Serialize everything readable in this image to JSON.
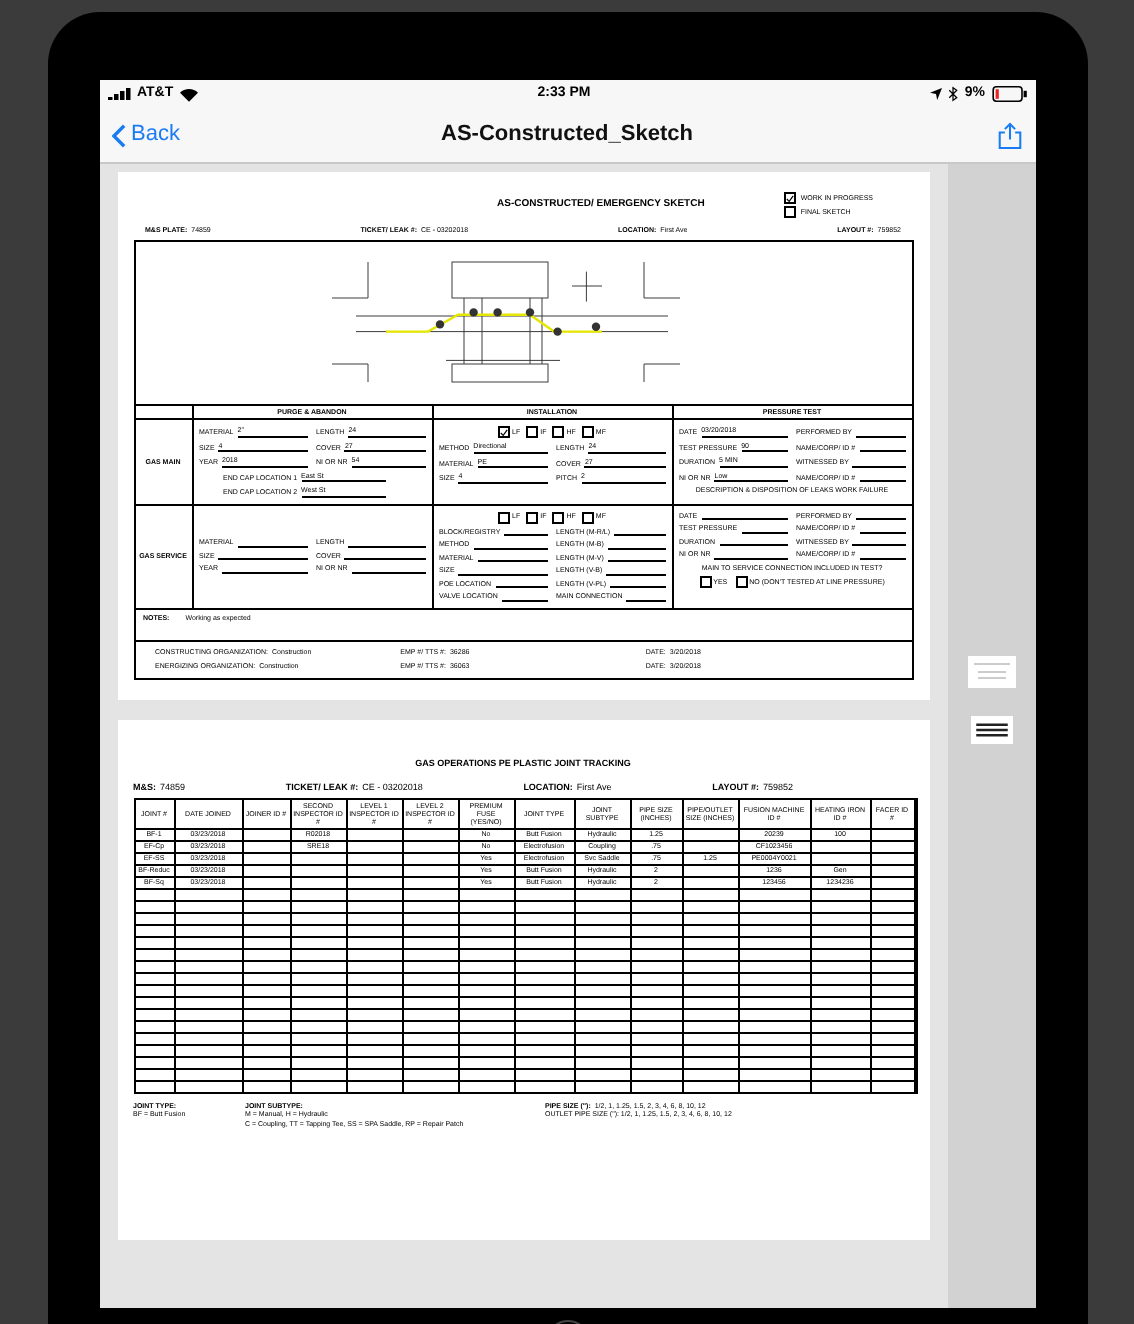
{
  "status_bar": {
    "carrier": "AT&T",
    "time": "2:33 PM",
    "battery": "9%"
  },
  "nav": {
    "back": "Back",
    "title": "AS-Constructed_Sketch"
  },
  "sketch_page": {
    "title": "AS-CONSTRUCTED/ EMERGENCY SKETCH",
    "checkboxes": [
      {
        "label": "WORK IN PROGRESS",
        "checked": true
      },
      {
        "label": "FINAL SKETCH",
        "checked": false
      }
    ],
    "info": [
      {
        "label": "M&S PLATE:",
        "value": "74859"
      },
      {
        "label": "TICKET/ LEAK #:",
        "value": "CE - 03202018"
      },
      {
        "label": "LOCATION:",
        "value": "First Ave"
      },
      {
        "label": "LAYOUT #:",
        "value": "759852"
      }
    ],
    "sections": [
      "PURGE & ABANDON",
      "INSTALLATION",
      "PRESSURE TEST"
    ],
    "rows": [
      {
        "label": "GAS MAIN",
        "purge": [
          {
            "label": "MATERIAL",
            "value": "2\""
          },
          {
            "label": "LENGTH",
            "value": "24"
          },
          {
            "label": "SIZE",
            "value": "4"
          },
          {
            "label": "COVER",
            "value": "27"
          },
          {
            "label": "YEAR",
            "value": "2018"
          },
          {
            "label": "NI OR NR",
            "value": "54"
          },
          {
            "label": "END CAP LOCATION 1",
            "value": "East St"
          },
          {
            "label": "END CAP LOCATION 2",
            "value": "West St"
          }
        ],
        "types": [
          {
            "label": "LF",
            "checked": true
          },
          {
            "label": "IF",
            "checked": false
          },
          {
            "label": "HF",
            "checked": false
          },
          {
            "label": "MF",
            "checked": false
          }
        ],
        "install": [
          {
            "label": "METHOD",
            "value": "Directional"
          },
          {
            "label": "LENGTH",
            "value": "24"
          },
          {
            "label": "MATERIAL",
            "value": "PE"
          },
          {
            "label": "COVER",
            "value": "27"
          },
          {
            "label": "SIZE",
            "value": "4"
          },
          {
            "label": "PITCH",
            "value": "2"
          }
        ],
        "pressure": [
          {
            "label": "DATE",
            "value": "03/20/2018"
          },
          {
            "label": "PERFORMED BY"
          },
          {
            "label": "TEST PRESSURE",
            "value": "90"
          },
          {
            "label": "NAME/CORP/ ID #"
          },
          {
            "label": "DURATION",
            "value": "5 MIN"
          },
          {
            "label": "WITNESSED BY"
          },
          {
            "label": "NI OR NR",
            "value": "Low"
          },
          {
            "label": "NAME/CORP/ ID #"
          }
        ],
        "pressure_note": "DESCRIPTION & DISPOSITION OF LEAKS WORK FAILURE"
      },
      {
        "label": "GAS SERVICE",
        "purge": [
          {
            "label": "MATERIAL"
          },
          {
            "label": "LENGTH"
          },
          {
            "label": "SIZE"
          },
          {
            "label": "COVER"
          },
          {
            "label": "YEAR"
          },
          {
            "label": "NI OR NR"
          }
        ],
        "types": [
          {
            "label": "LF",
            "checked": false
          },
          {
            "label": "IF",
            "checked": false
          },
          {
            "label": "HF",
            "checked": false
          },
          {
            "label": "MF",
            "checked": false
          }
        ],
        "install": [
          {
            "label": "BLOCK/REGISTRY"
          },
          {
            "label": "LENGTH (M-R/L)"
          },
          {
            "label": "METHOD"
          },
          {
            "label": "LENGTH (M-B)"
          },
          {
            "label": "MATERIAL"
          },
          {
            "label": "LENGTH (M-V)"
          },
          {
            "label": "SIZE"
          },
          {
            "label": "LENGTH (V-B)"
          },
          {
            "label": "POE LOCATION"
          },
          {
            "label": "LENGTH (V-PL)"
          },
          {
            "label": "VALVE LOCATION"
          },
          {
            "label": "MAIN CONNECTION"
          }
        ],
        "pressure": [
          {
            "label": "DATE"
          },
          {
            "label": "PERFORMED BY"
          },
          {
            "label": "TEST PRESSURE"
          },
          {
            "label": "NAME/CORP/ ID #"
          },
          {
            "label": "DURATION"
          },
          {
            "label": "WITNESSED BY"
          },
          {
            "label": "NI OR NR"
          },
          {
            "label": "NAME/CORP/ ID #"
          }
        ],
        "pressure_note": "MAIN TO SERVICE CONNECTION INCLUDED IN TEST?",
        "answers": [
          {
            "label": "YES",
            "checked": false
          },
          {
            "label": "NO (DON'T TESTED AT LINE PRESSURE)",
            "checked": false
          }
        ]
      }
    ],
    "notes": {
      "label": "NOTES:",
      "value": "Working as expected"
    },
    "orgs": [
      [
        {
          "label": "CONSTRUCTING ORGANIZATION:",
          "value": "Construction"
        },
        {
          "label": "EMP #/ TTS #:",
          "value": "36286"
        },
        {
          "label": "DATE:",
          "value": "3/20/2018"
        }
      ],
      [
        {
          "label": "ENERGIZING ORGANIZATION:",
          "value": "Construction"
        },
        {
          "label": "EMP #/ TTS #:",
          "value": "36063"
        },
        {
          "label": "DATE:",
          "value": "3/20/2018"
        }
      ]
    ]
  },
  "joint_page": {
    "title": "GAS OPERATIONS PE PLASTIC JOINT TRACKING",
    "info": [
      {
        "label": "M&S:",
        "value": "74859"
      },
      {
        "label": "TICKET/ LEAK #:",
        "value": "CE - 03202018"
      },
      {
        "label": "LOCATION:",
        "value": "First Ave"
      },
      {
        "label": "LAYOUT #:",
        "value": "759852"
      }
    ],
    "columns": [
      "JOINT #",
      "DATE JOINED",
      "JOINER ID #",
      "SECOND INSPECTOR ID #",
      "LEVEL 1 INSPECTOR ID #",
      "LEVEL 2 INSPECTOR ID #",
      "PREMIUM FUSE (YES/NO)",
      "JOINT TYPE",
      "JOINT SUBTYPE",
      "PIPE SIZE (INCHES)",
      "PIPE/OUTLET SIZE (INCHES)",
      "FUSION MACHINE ID #",
      "HEATING IRON ID #",
      "FACER ID #"
    ],
    "rows": [
      [
        "BF-1",
        "03/23/2018",
        "",
        "R02018",
        "",
        "",
        "No",
        "Butt Fusion",
        "Hydraulic",
        "1.25",
        "",
        "20239",
        "100",
        ""
      ],
      [
        "EF-Cp",
        "03/23/2018",
        "",
        "SRE18",
        "",
        "",
        "No",
        "Electrofusion",
        "Coupling",
        ".75",
        "",
        "CF1023456",
        "",
        ""
      ],
      [
        "EF-SS",
        "03/23/2018",
        "",
        "",
        "",
        "",
        "Yes",
        "Electrofusion",
        "Svc Saddle",
        ".75",
        "1.25",
        "PE0004Y0021",
        "",
        ""
      ],
      [
        "BF-Reduc",
        "03/23/2018",
        "",
        "",
        "",
        "",
        "Yes",
        "Butt Fusion",
        "Hydraulic",
        "2",
        "",
        "1236",
        "Gen",
        ""
      ],
      [
        "BF-Sq",
        "03/23/2018",
        "",
        "",
        "",
        "",
        "Yes",
        "Butt Fusion",
        "Hydraulic",
        "2",
        "",
        "123456",
        "1234236",
        ""
      ]
    ],
    "legend": [
      {
        "label": "JOINT TYPE:",
        "lines": [
          "BF = Butt Fusion"
        ]
      },
      {
        "label": "JOINT SUBTYPE:",
        "lines": [
          "M = Manual, H = Hydraulic",
          "C = Coupling, TT = Tapping Tee, SS = SPA Saddle, RP = Repair Patch"
        ]
      },
      {
        "label": "PIPE SIZE (\"):",
        "lines": [
          "OUTLET PIPE SIZE (\"): 1/2, 1, 1.25, 1.5, 2, 3, 4, 6, 8, 10, 12"
        ],
        "value": "1/2, 1, 1.25, 1.5, 2, 3, 4, 6, 8, 10, 12"
      }
    ]
  }
}
